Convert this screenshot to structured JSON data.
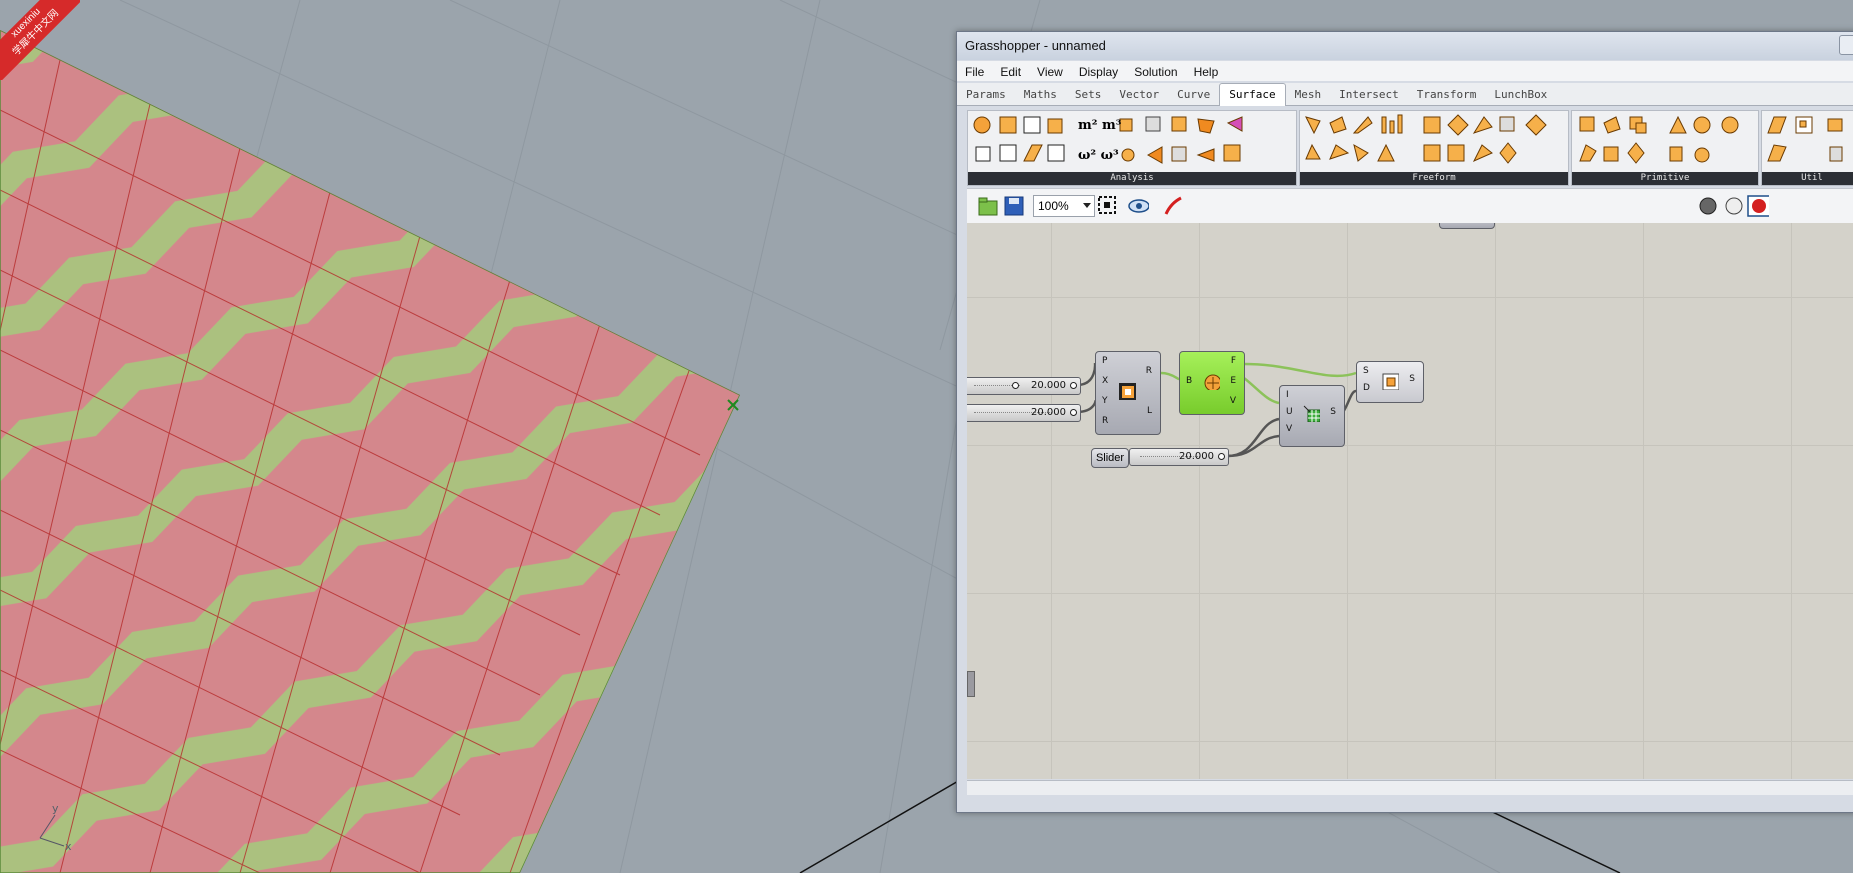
{
  "watermark": {
    "line1": "xuexiniu",
    "line2": "学犀牛中文网"
  },
  "viewport": {
    "axis_y": "y",
    "axis_x": "x"
  },
  "grasshopper": {
    "title": "Grasshopper - unnamed",
    "menu": [
      "File",
      "Edit",
      "View",
      "Display",
      "Solution",
      "Help"
    ],
    "tabs": [
      "Params",
      "Maths",
      "Sets",
      "Vector",
      "Curve",
      "Surface",
      "Mesh",
      "Intersect",
      "Transform",
      "LunchBox"
    ],
    "active_tab": "Surface",
    "ribbon_groups": [
      "Analysis",
      "Freeform",
      "Primitive",
      "Util"
    ],
    "toolbar": {
      "zoom": "100%"
    },
    "canvas": {
      "slider_a_value": "20.000",
      "slider_b_value": "20.000",
      "slider_c_label": "Slider",
      "slider_c_value": "20.000",
      "rectangle_inputs": [
        "P",
        "X",
        "Y",
        "R"
      ],
      "rectangle_outputs": [
        "R",
        "L"
      ],
      "brep_edges_input": "B",
      "brep_edges_outputs": [
        "F",
        "E",
        "V"
      ],
      "divide_inputs": [
        "I",
        "U",
        "V"
      ],
      "divide_output": "S",
      "split_inputs": [
        "S",
        "D"
      ],
      "split_output": "S"
    }
  },
  "colors": {
    "surface_red": "#d4878c",
    "surface_green": "#a8c47e",
    "grid_line": "#b52a2a",
    "viewport_bg": "#9ba4ac"
  }
}
